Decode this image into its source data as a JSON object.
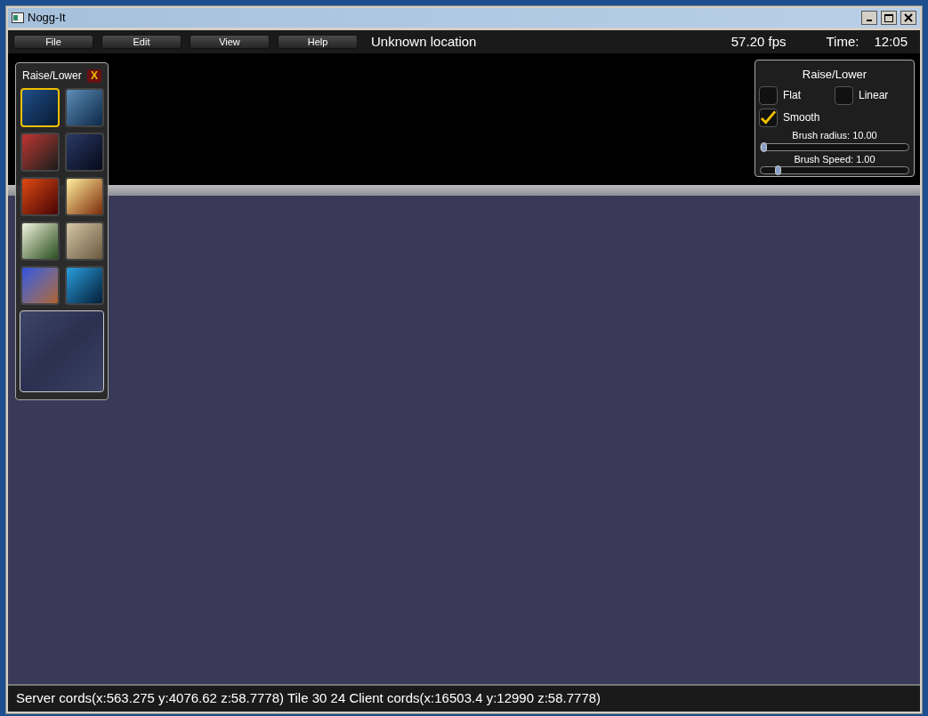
{
  "window": {
    "title": "Nogg-It"
  },
  "menu": [
    {
      "label": "File"
    },
    {
      "label": "Edit"
    },
    {
      "label": "View"
    },
    {
      "label": "Help"
    }
  ],
  "location": "Unknown location",
  "fps": "57.20 fps",
  "time_label": "Time:",
  "time": "12:05",
  "toolbox": {
    "title": "Raise/Lower",
    "close": "X",
    "tools": [
      {
        "selected": true
      },
      {
        "selected": false
      },
      {
        "selected": false
      },
      {
        "selected": false
      },
      {
        "selected": false
      },
      {
        "selected": false
      },
      {
        "selected": false
      },
      {
        "selected": false
      },
      {
        "selected": false
      },
      {
        "selected": false
      }
    ]
  },
  "settings": {
    "title": "Raise/Lower",
    "checkboxes": [
      {
        "label": "Flat",
        "checked": false
      },
      {
        "label": "Linear",
        "checked": false
      },
      {
        "label": "Smooth",
        "checked": true
      }
    ],
    "sliders": [
      {
        "label": "Brush radius: 10.00",
        "level": 0.0
      },
      {
        "label": "Brush Speed: 1.00",
        "level": 0.1
      }
    ]
  },
  "status": "Server cords(x:563.275 y:4076.62 z:58.7778) Tile 30 24 Client cords(x:16503.4 y:12990 z:58.7778)"
}
